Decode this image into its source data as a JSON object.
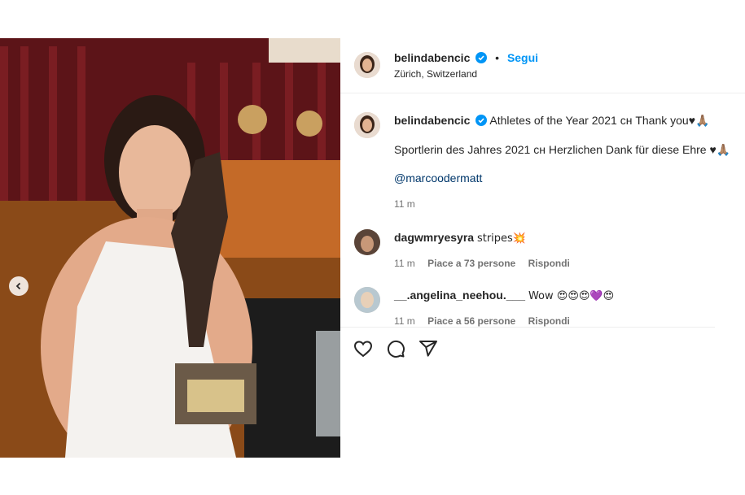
{
  "post": {
    "username": "belindabencic",
    "follow_label": "Segui",
    "separator": "•",
    "location": "Zürich, Switzerland",
    "caption_line1": "Athletes of the Year 2021 сн Thank you♥🙏🏽",
    "caption_line2": "Sportlerin des Jahres 2021 сн Herzlichen Dank für diese Ehre ♥🙏🏽",
    "mention": "@marcoodermatt",
    "time": "11 m",
    "image_dots": 2,
    "image_active_dot": 2
  },
  "comments": [
    {
      "username": "dagwmryesyra",
      "text": "stripes💥",
      "time": "11 m",
      "likes": "Piace a 73 persone",
      "reply_label": "Rispondi"
    },
    {
      "username": "__.angelina_neehou.___",
      "text": "Wow 😍😍😍💜😍",
      "time": "11 m",
      "likes": "Piace a 56 persone",
      "reply_label": "Rispondi"
    }
  ],
  "icons": {
    "verified": "verified-badge-icon",
    "like": "heart-icon",
    "comment": "comment-icon",
    "share": "share-icon",
    "prev": "chevron-left-icon"
  },
  "colors": {
    "accent": "#0095f6",
    "verified": "#0095f6",
    "link": "#00376b",
    "meta": "#737373"
  }
}
